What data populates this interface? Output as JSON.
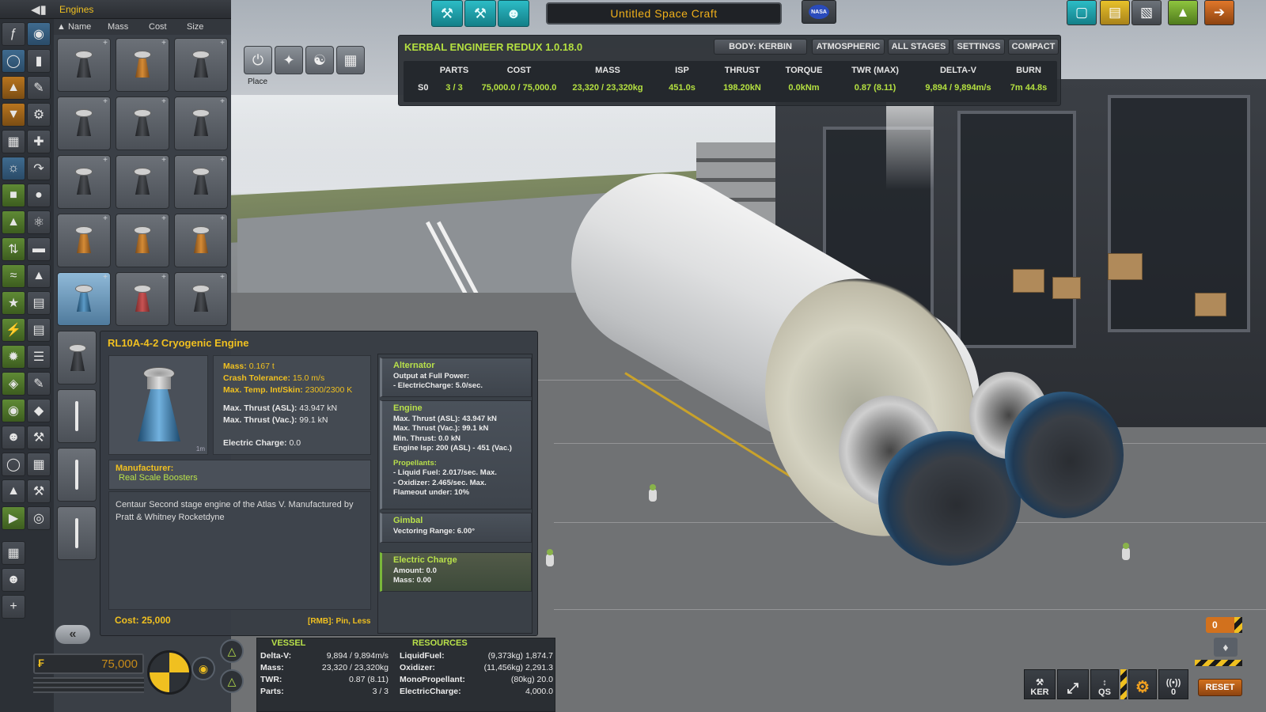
{
  "app": {
    "category_title": "Engines",
    "ship_name": "Untitled Space Craft"
  },
  "sort": {
    "name": "Name",
    "mass": "Mass",
    "cost": "Cost",
    "size": "Size"
  },
  "editor_modes": {
    "place_label": "Place"
  },
  "engineer": {
    "title": "KERBAL ENGINEER REDUX 1.0.18.0",
    "buttons": [
      "BODY: KERBIN",
      "ATMOSPHERIC",
      "ALL STAGES",
      "SETTINGS",
      "COMPACT"
    ],
    "headers": [
      "PARTS",
      "COST",
      "MASS",
      "ISP",
      "THRUST",
      "TORQUE",
      "TWR (MAX)",
      "DELTA-V",
      "BURN"
    ],
    "stage_label": "S0",
    "values": [
      "3 / 3",
      "75,000.0 / 75,000.0",
      "23,320 / 23,320kg",
      "451.0s",
      "198.20kN",
      "0.0kNm",
      "0.87 (8.11)",
      "9,894 / 9,894m/s",
      "7m 44.8s"
    ]
  },
  "tooltip": {
    "title": "RL10A-4-2 Cryogenic Engine",
    "size_label": "1m",
    "mass_label": "Mass:",
    "mass_value": "0.167 t",
    "crash_label": "Crash Tolerance:",
    "crash_value": "15.0 m/s",
    "temp_label": "Max. Temp. Int/Skin:",
    "temp_value": "2300/2300 K",
    "thrust_asl_label": "Max. Thrust (ASL):",
    "thrust_asl_value": "43.947 kN",
    "thrust_vac_label": "Max. Thrust (Vac.):",
    "thrust_vac_value": "99.1 kN",
    "ec_label": "Electric Charge:",
    "ec_value": "0.0",
    "manufacturer_label": "Manufacturer:",
    "manufacturer_value": "Real Scale Boosters",
    "description": "Centaur Second stage engine of the Atlas V. Manufactured by Pratt & Whitney Rocketdyne",
    "cost": "Cost: 25,000",
    "rmb_hint": "[RMB]: Pin, Less",
    "modules": [
      {
        "title": "Alternator",
        "lines": [
          "Output at Full Power:",
          "- ElectricCharge: 5.0/sec."
        ]
      },
      {
        "title": "Engine",
        "lines": [
          "Max. Thrust (ASL): 43.947 kN",
          "Max. Thrust (Vac.): 99.1 kN",
          "Min. Thrust: 0.0 kN",
          "Engine Isp: 200 (ASL) - 451 (Vac.)"
        ],
        "sub": "Propellants:",
        "sub_lines": [
          "- Liquid Fuel: 2.017/sec. Max.",
          "- Oxidizer: 2.465/sec. Max.",
          "Flameout under: 10%"
        ]
      },
      {
        "title": "Gimbal",
        "lines": [
          "Vectoring Range: 6.00°"
        ]
      },
      {
        "title": "Electric Charge",
        "lines": [
          "Amount: 0.0",
          "Mass: 0.00"
        ]
      }
    ]
  },
  "bottom": {
    "funds": "75,000",
    "vessel_header": "VESSEL",
    "resources_header": "RESOURCES",
    "vessel_rows": [
      {
        "label": "Delta-V:",
        "value": "9,894 / 9,894m/s"
      },
      {
        "label": "Mass:",
        "value": "23,320 / 23,320kg"
      },
      {
        "label": "TWR:",
        "value": "0.87 (8.11)"
      },
      {
        "label": "Parts:",
        "value": "3 / 3"
      }
    ],
    "resource_rows": [
      {
        "label": "LiquidFuel:",
        "value": "(9,373kg) 1,874.7"
      },
      {
        "label": "Oxidizer:",
        "value": "(11,456kg) 2,291.3"
      },
      {
        "label": "MonoPropellant:",
        "value": "(80kg) 20.0"
      },
      {
        "label": "ElectricCharge:",
        "value": "4,000.0"
      }
    ],
    "ker_label": "KER",
    "qs_label": "QS",
    "signal_count": "0",
    "stage_number": "0",
    "reset_label": "RESET"
  },
  "colors": {
    "accent_yellow": "#f0c020",
    "accent_green": "#b4e040",
    "teal": "#2cbcc6",
    "orange": "#d2711d"
  },
  "icons": [
    "back-arrow-icon",
    "formula-icon",
    "pod-icon",
    "fuel-tank-icon",
    "engine-icon",
    "gear-icon",
    "wrench-icon",
    "crane-icon",
    "wing-icon",
    "flag-icon",
    "save-icon",
    "load-icon",
    "new-icon",
    "launch-icon",
    "exit-icon"
  ]
}
